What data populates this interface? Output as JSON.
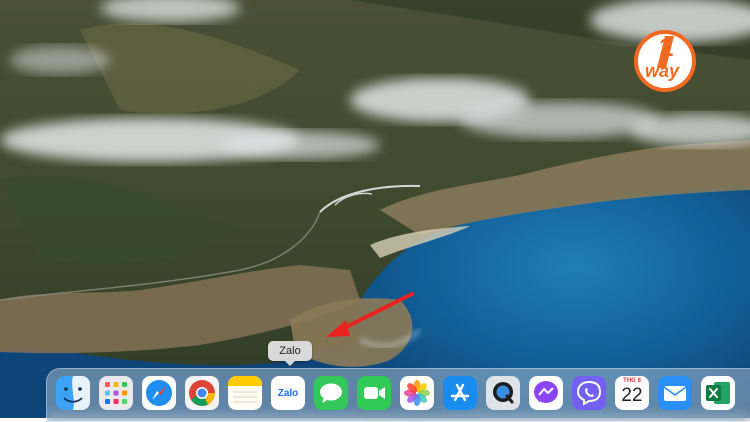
{
  "tooltip": {
    "label": "Zalo"
  },
  "watermark": {
    "text": "way",
    "digit": "1"
  },
  "dock": {
    "items": [
      {
        "name": "finder",
        "icon": "finder-icon"
      },
      {
        "name": "launchpad",
        "icon": "launchpad-icon"
      },
      {
        "name": "safari",
        "icon": "safari-icon"
      },
      {
        "name": "chrome",
        "icon": "chrome-icon"
      },
      {
        "name": "notes",
        "icon": "notes-icon"
      },
      {
        "name": "zalo",
        "icon": "zalo-icon",
        "label": "Zalo"
      },
      {
        "name": "messages",
        "icon": "messages-icon"
      },
      {
        "name": "facetime",
        "icon": "facetime-icon"
      },
      {
        "name": "photos",
        "icon": "photos-icon"
      },
      {
        "name": "app-store",
        "icon": "app-store-icon"
      },
      {
        "name": "quicktime",
        "icon": "quicktime-icon"
      },
      {
        "name": "messenger",
        "icon": "messenger-icon"
      },
      {
        "name": "viber",
        "icon": "viber-icon"
      },
      {
        "name": "calendar",
        "icon": "calendar-icon",
        "month": "THG 8",
        "day": "22"
      },
      {
        "name": "mail",
        "icon": "mail-icon"
      },
      {
        "name": "excel",
        "icon": "excel-icon"
      }
    ]
  },
  "colors": {
    "accent": "#e8231f",
    "ocean": "#0e4f86",
    "logo_orange": "#f26a21"
  }
}
